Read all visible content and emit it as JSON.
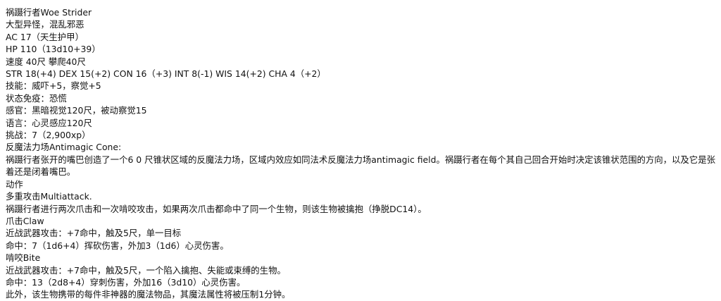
{
  "statblock": {
    "name": "祸蹑行者Woe Strider",
    "type": "大型异怪，混乱邪恶",
    "ac": "AC 17（天生护甲）",
    "hp": "HP 110（13d10+39）",
    "speed": "速度 40尺 攀爬40尺",
    "abilities": "STR 18(+4) DEX 15(+2) CON 16（+3) INT 8(-1) WIS 14(+2) CHA 4（+2）",
    "skills": "技能：威吓+5，察觉+5",
    "condition_immunities": "状态免疫：恐慌",
    "senses": "感官：黑暗视觉120尺，被动察觉15",
    "languages": "语言：心灵感应120尺",
    "challenge": "挑战：7（2,900xp）",
    "traits": [
      {
        "title": "反魔法力场Antimagic Cone:",
        "text": "祸蹑行者张开的嘴巴创造了一个6 0 尺锥状区域的反魔法力场，区域内效应如同法术反魔法力场antimagic field。祸蹑行者在每个其自己回合开始时决定该锥状范围的方向，以及它是张着还是闭着嘴巴。"
      }
    ],
    "actions_heading": "动作",
    "actions": [
      {
        "title": "多重攻击Multiattack.",
        "lines": [
          "祸蹑行者进行两次爪击和一次啃咬攻击，如果两次爪击都命中了同一个生物，则该生物被擒抱（挣脱DC14）。"
        ]
      },
      {
        "title": "爪击Claw",
        "lines": [
          "近战武器攻击：+7命中，触及5尺，单一目标",
          "命中：7（1d6+4）挥砍伤害，外加3（1d6）心灵伤害。"
        ]
      },
      {
        "title": "啃咬Bite",
        "lines": [
          "近战武器攻击：+7命中，触及5尺，一个陷入擒抱、失能或束缚的生物。",
          "命中：13（2d8+4）穿刺伤害，外加16（3d10）心灵伤害。",
          "此外，该生物携带的每件非神器的魔法物品，其魔法属性将被压制1分钟。"
        ]
      }
    ]
  }
}
